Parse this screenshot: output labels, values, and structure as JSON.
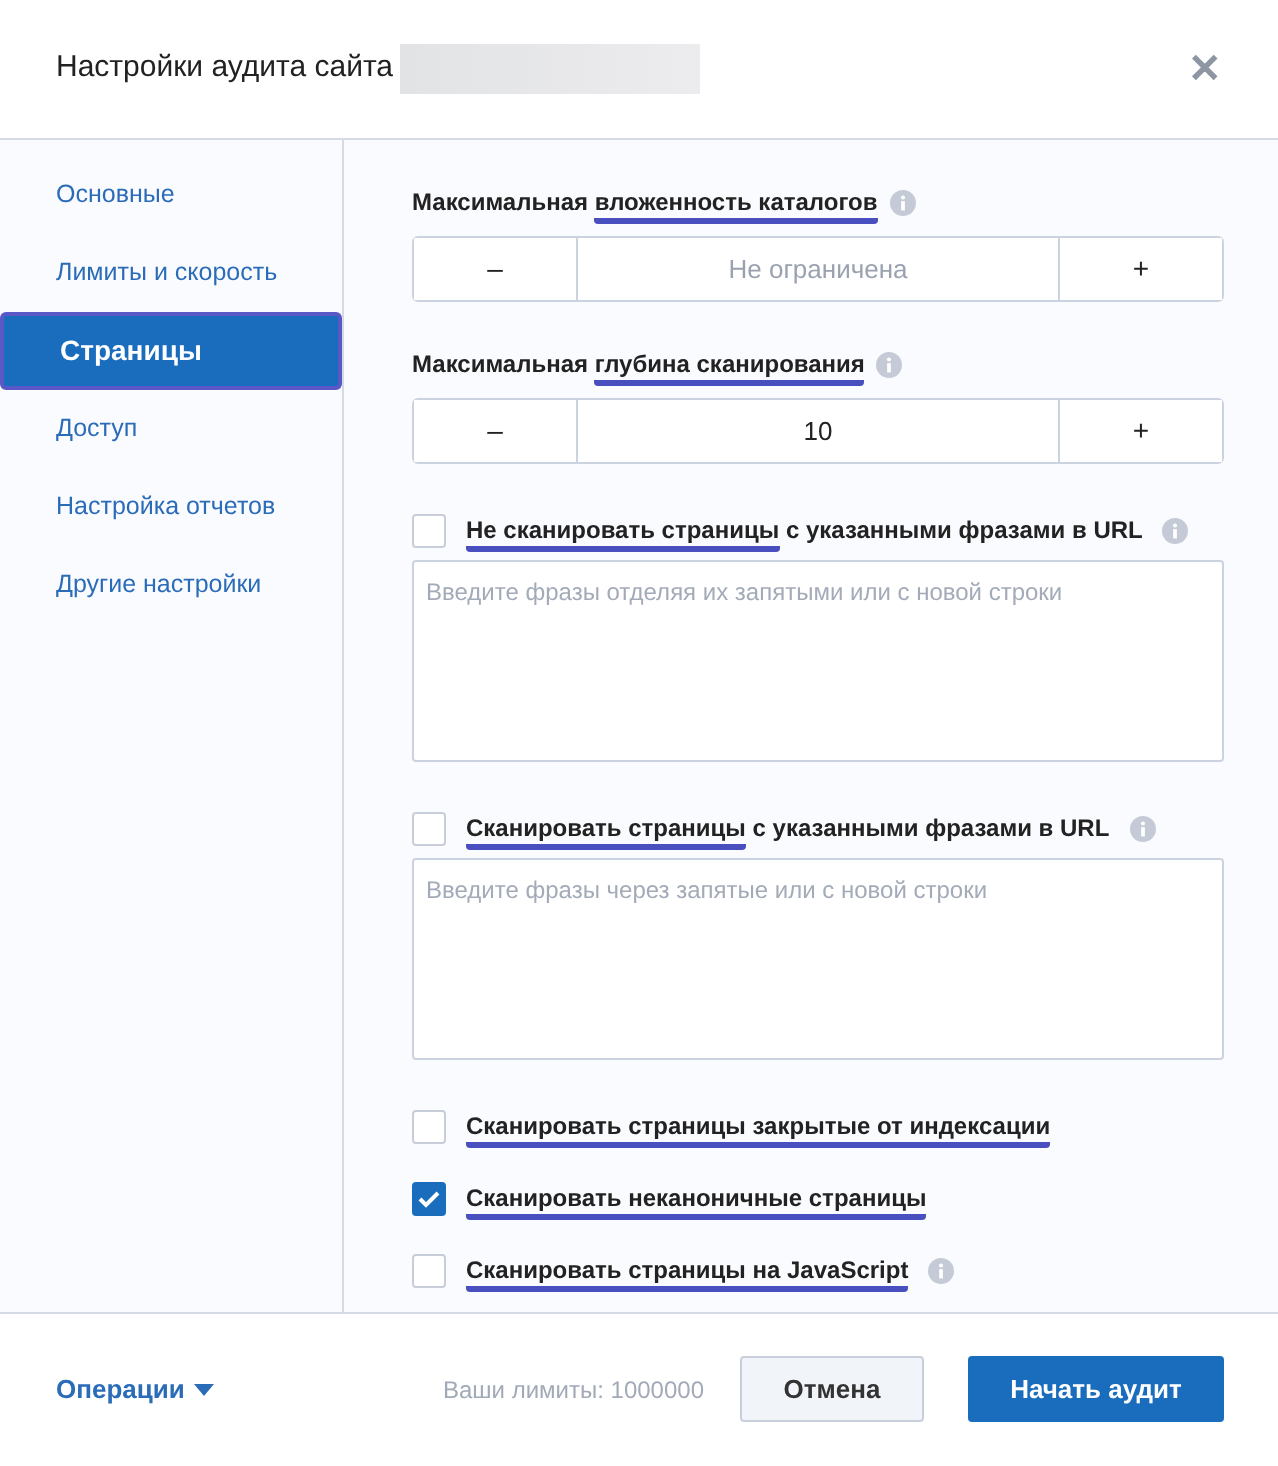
{
  "window": {
    "title": "Настройки аудита сайта",
    "redacted": true,
    "close": "✕"
  },
  "sidebar": {
    "items": [
      {
        "label": "Основные",
        "selected": false
      },
      {
        "label": "Лимиты и скорость",
        "selected": false
      },
      {
        "label": "Страницы",
        "selected": true
      },
      {
        "label": "Доступ",
        "selected": false
      },
      {
        "label": "Настройка отчетов",
        "selected": false
      },
      {
        "label": "Другие настройки",
        "selected": false
      }
    ]
  },
  "settings": [
    {
      "kind": "stepper",
      "label": [
        {
          "text": "Максимальная ",
          "underlined": false
        },
        {
          "text": "вложенность каталогов",
          "underlined": true
        }
      ],
      "info": true,
      "minus": "–",
      "plus": "+",
      "value": "Не ограничена",
      "empty": true
    },
    {
      "kind": "stepper",
      "label": [
        {
          "text": "Максимальная ",
          "underlined": false
        },
        {
          "text": "глубина сканирования",
          "underlined": true
        }
      ],
      "info": true,
      "minus": "–",
      "plus": "+",
      "value": "10",
      "empty": false
    },
    {
      "kind": "textarea",
      "checked": false,
      "label": [
        {
          "text": "Не сканировать страницы",
          "underlined": true
        },
        {
          "text": " с указанными фразами в URL",
          "underlined": false
        }
      ],
      "info": true,
      "placeholder": "Введите фразы отделяя их запятыми или с новой строки"
    },
    {
      "kind": "textarea",
      "checked": false,
      "label": [
        {
          "text": "Сканировать страницы",
          "underlined": true
        },
        {
          "text": " с указанными фразами в URL",
          "underlined": false
        }
      ],
      "info": true,
      "placeholder": "Введите фразы через запятые или с новой строки"
    },
    {
      "kind": "checkbox",
      "checked": false,
      "label": [
        {
          "text": "Сканировать страницы закрытые от индексации",
          "underlined": true
        }
      ],
      "info": false
    },
    {
      "kind": "checkbox",
      "checked": true,
      "label": [
        {
          "text": "Сканировать неканоничные страницы",
          "underlined": true
        }
      ],
      "info": false
    },
    {
      "kind": "checkbox",
      "checked": false,
      "label": [
        {
          "text": "Сканировать страницы на JavaScript",
          "underlined": true
        }
      ],
      "info": true
    }
  ],
  "footer": {
    "operations": "Операции",
    "limits": "Ваши лимиты: 1000000",
    "cancel": "Отмена",
    "start": "Начать аудит"
  }
}
